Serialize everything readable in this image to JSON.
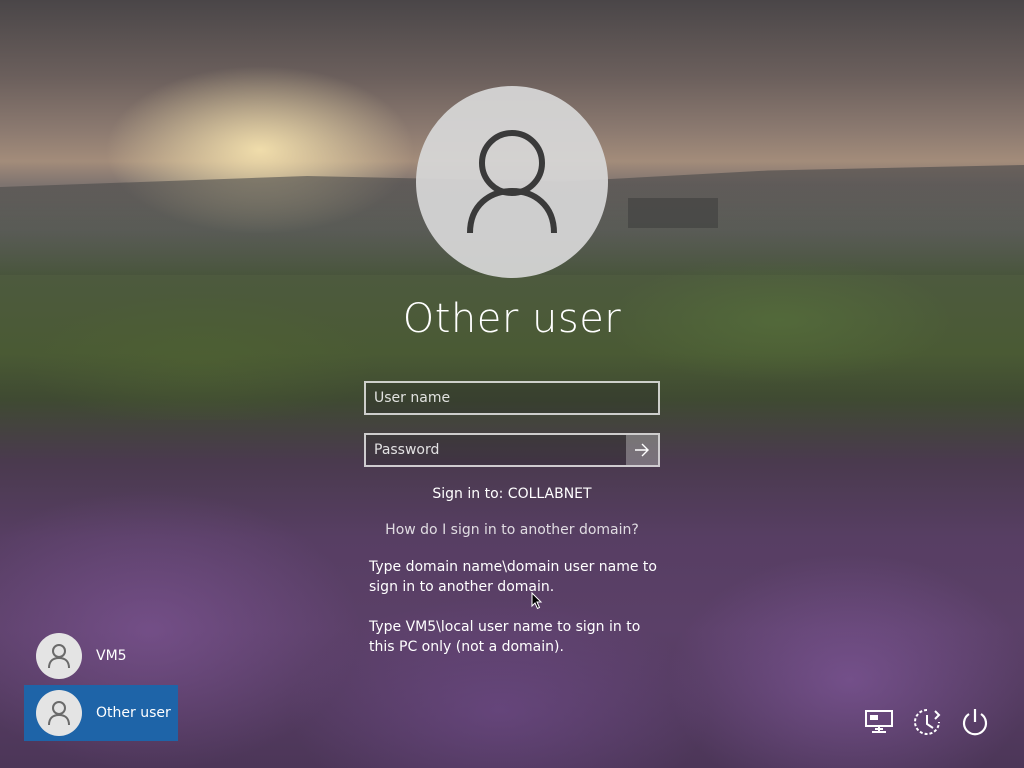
{
  "login": {
    "display_name": "Other user",
    "username_placeholder": "User name",
    "password_placeholder": "Password",
    "sign_in_to": "Sign in to: COLLABNET",
    "domain_help_link": "How do I sign in to another domain?",
    "help_line_1": "Type domain name\\domain user name to sign in to another domain.",
    "help_line_2": "Type VM5\\local user name to sign in to this PC only (not a domain)."
  },
  "users": [
    {
      "name": "VM5",
      "selected": false
    },
    {
      "name": "Other user",
      "selected": true
    }
  ],
  "system_icons": [
    "network-icon",
    "ease-of-access-icon",
    "power-icon"
  ],
  "colors": {
    "selected_user_bg": "#1e64a8",
    "text": "#ffffff"
  }
}
